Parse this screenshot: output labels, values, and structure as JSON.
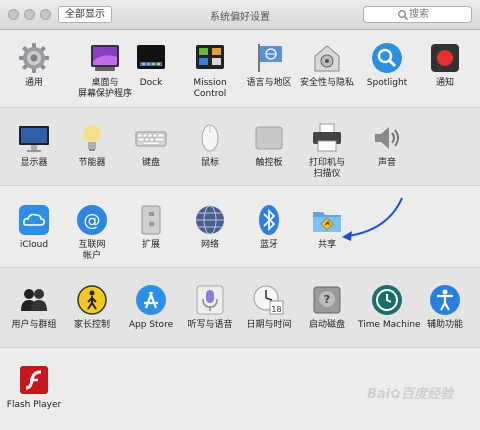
{
  "window": {
    "title": "系统偏好设置",
    "show_all_label": "全部显示",
    "search_placeholder": "搜索"
  },
  "sections": [
    {
      "items": [
        {
          "label": "通用",
          "icon": "general-icon"
        },
        {
          "label": "桌面与\n屏幕保护程序",
          "icon": "desktop-screensaver-icon"
        },
        {
          "label": "Dock",
          "icon": "dock-icon"
        },
        {
          "label": "Mission\nControl",
          "icon": "mission-control-icon"
        },
        {
          "label": "语言与地区",
          "icon": "language-region-icon"
        },
        {
          "label": "安全性与隐私",
          "icon": "security-privacy-icon"
        },
        {
          "label": "Spotlight",
          "icon": "spotlight-icon"
        },
        {
          "label": "通知",
          "icon": "notifications-icon"
        }
      ]
    },
    {
      "items": [
        {
          "label": "显示器",
          "icon": "displays-icon"
        },
        {
          "label": "节能器",
          "icon": "energy-saver-icon"
        },
        {
          "label": "键盘",
          "icon": "keyboard-icon"
        },
        {
          "label": "鼠标",
          "icon": "mouse-icon"
        },
        {
          "label": "触控板",
          "icon": "trackpad-icon"
        },
        {
          "label": "打印机与\n扫描仪",
          "icon": "printers-scanners-icon"
        },
        {
          "label": "声音",
          "icon": "sound-icon"
        }
      ]
    },
    {
      "items": [
        {
          "label": "iCloud",
          "icon": "icloud-icon"
        },
        {
          "label": "互联网\n帐户",
          "icon": "internet-accounts-icon"
        },
        {
          "label": "扩展",
          "icon": "extensions-icon"
        },
        {
          "label": "网络",
          "icon": "network-icon"
        },
        {
          "label": "蓝牙",
          "icon": "bluetooth-icon"
        },
        {
          "label": "共享",
          "icon": "sharing-icon"
        }
      ]
    },
    {
      "items": [
        {
          "label": "用户与群组",
          "icon": "users-groups-icon"
        },
        {
          "label": "家长控制",
          "icon": "parental-controls-icon"
        },
        {
          "label": "App Store",
          "icon": "app-store-icon"
        },
        {
          "label": "听写与语音",
          "icon": "dictation-speech-icon"
        },
        {
          "label": "日期与时间",
          "icon": "date-time-icon"
        },
        {
          "label": "启动磁盘",
          "icon": "startup-disk-icon"
        },
        {
          "label": "Time Machine",
          "icon": "time-machine-icon"
        },
        {
          "label": "辅助功能",
          "icon": "accessibility-icon"
        }
      ]
    },
    {
      "items": [
        {
          "label": "Flash Player",
          "icon": "flash-player-icon"
        }
      ]
    }
  ],
  "watermark": "Bai✿百度经验"
}
